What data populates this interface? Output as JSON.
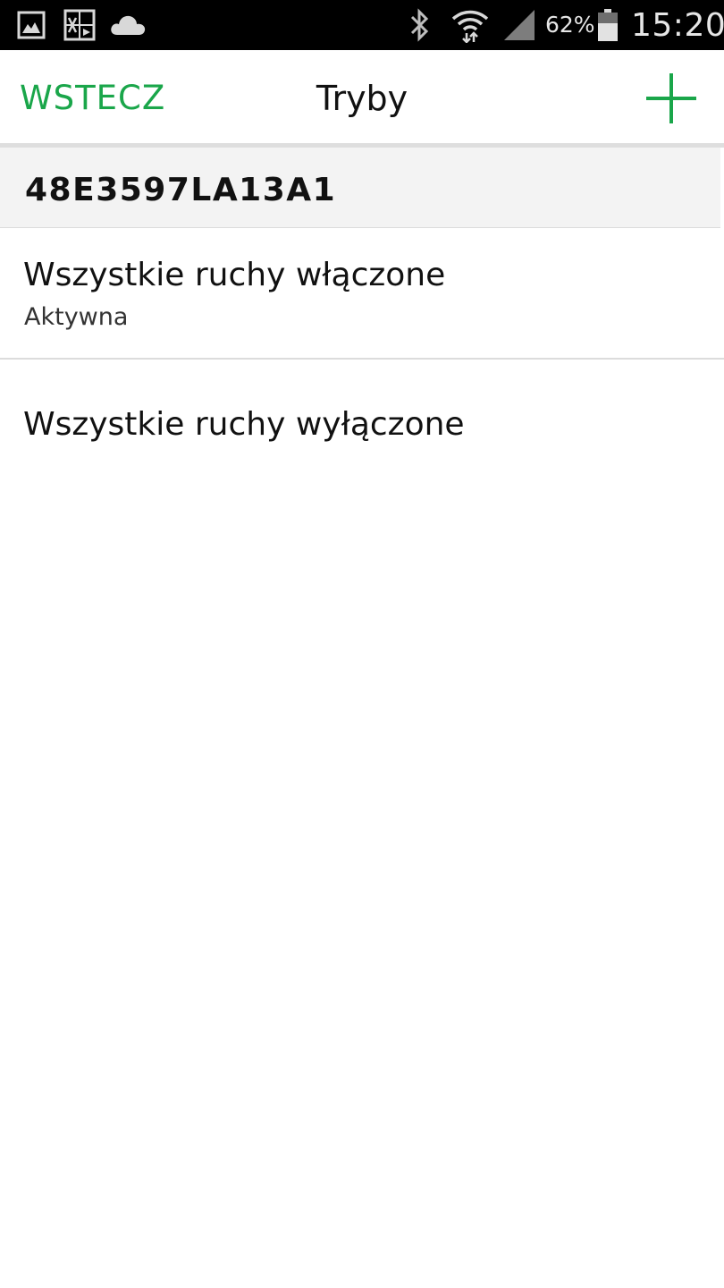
{
  "status_bar": {
    "icons_left": [
      "gallery-icon",
      "screenshot-icon",
      "cloud-icon"
    ],
    "icons_right": [
      "bluetooth-icon",
      "wifi-icon",
      "signal-icon",
      "battery-icon"
    ],
    "battery_percent": "62%",
    "time": "15:20"
  },
  "header": {
    "back_label": "WSTECZ",
    "title": "Tryby",
    "add_icon": "plus-icon"
  },
  "device": {
    "id": "48E3597LA13A1"
  },
  "modes": [
    {
      "name": "Wszystkie ruchy włączone",
      "status": "Aktywna"
    },
    {
      "name": "Wszystkie ruchy wyłączone",
      "status": ""
    }
  ],
  "colors": {
    "accent": "#1aa64a",
    "status_bar_bg": "#000000",
    "section_bg": "#f3f3f3",
    "divider": "#dcdcdc"
  }
}
